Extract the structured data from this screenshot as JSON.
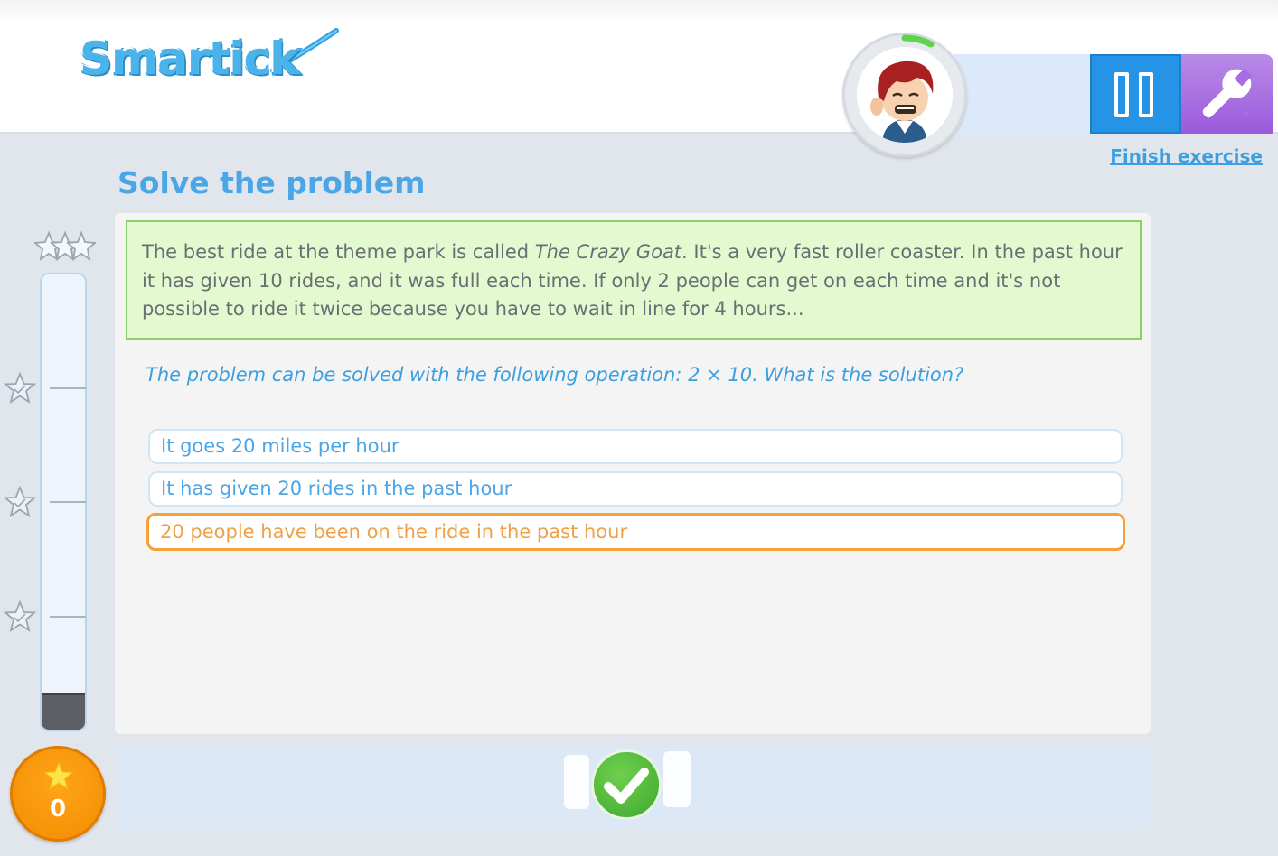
{
  "app": {
    "logo_text": "Smartick"
  },
  "header": {
    "finish_link": "Finish exercise",
    "icons": {
      "pause": "pause-icon",
      "settings": "wrench-icon",
      "avatar": "avatar-icon"
    }
  },
  "page": {
    "title": "Solve the problem"
  },
  "problem": {
    "text_before_title": "The best ride at the theme park is called ",
    "ride_name": "The Crazy Goat",
    "text_after_title": ". It's a very fast roller coaster. In the past hour it has given 10 rides, and it was full each time. If only 2 people can get on each time and it's not possible to ride it twice because you have to wait in line for 4 hours...",
    "question": "The problem can be solved with the following operation: 2 × 10. What is the solution?"
  },
  "options": [
    {
      "label": "It goes 20 miles per hour",
      "selected": false
    },
    {
      "label": "It has given 20 rides in the past hour",
      "selected": false
    },
    {
      "label": "20 people have been on the ride in the past hour",
      "selected": true
    }
  ],
  "progress": {
    "fill_fraction": 0.08,
    "level_marks": 3
  },
  "score": {
    "value": "0",
    "icon": "star-icon"
  },
  "footer": {
    "submit_icon": "checkmark-icon"
  },
  "colors": {
    "accent_blue": "#4aa6e6",
    "problem_bg": "#e3fad1",
    "selected_orange": "#f5a13a",
    "check_green": "#4cb935",
    "score_orange": "#f38d00",
    "pause_blue": "#2594e6",
    "settings_purple": "#a86ee0"
  }
}
